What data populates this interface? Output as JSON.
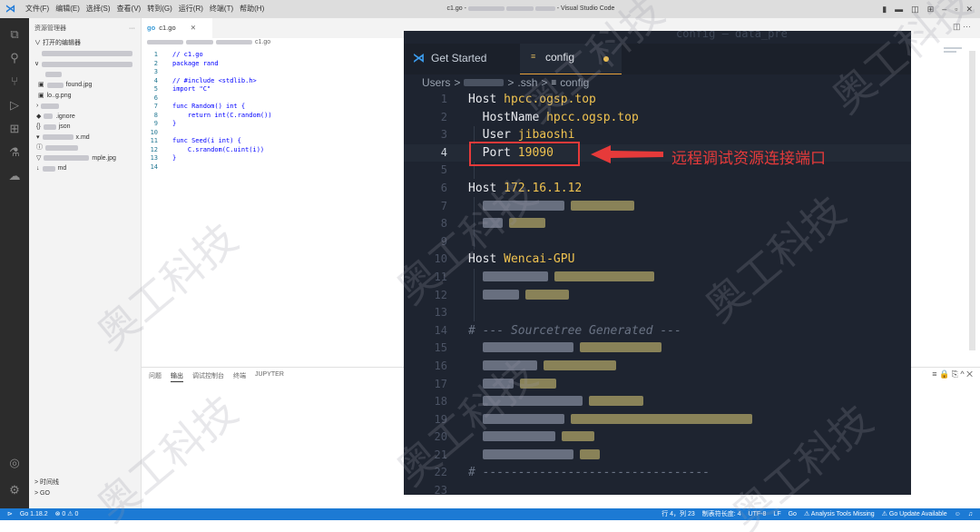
{
  "titlebar": {
    "menus": [
      "文件(F)",
      "编辑(E)",
      "选择(S)",
      "查看(V)",
      "转到(G)",
      "运行(R)",
      "终端(T)",
      "帮助(H)"
    ],
    "window_title": "c1.go - Visual Studio Code",
    "title_prefix": "c1.go -",
    "title_suffix": "- Visual Studio Code"
  },
  "sidebar": {
    "header": "资源管理器",
    "more": "···",
    "open_editors": "∨ 打开的编辑器",
    "files": {
      "found": "found.jpg",
      "logo": "lo..g.png",
      "ignore": ".ignore",
      "json": "json",
      "md": "x.md",
      "png": "mple.jpg",
      "readme": "md"
    },
    "outline": "> 时间线",
    "go": "> GO"
  },
  "editor": {
    "tab_label": "c1.go",
    "tab_icon": "go",
    "breadcrumb_file": "c1.go",
    "lines": [
      {
        "n": "1",
        "t": "// c1.go"
      },
      {
        "n": "2",
        "t": "package rand"
      },
      {
        "n": "3",
        "t": ""
      },
      {
        "n": "4",
        "t": "// #include <stdlib.h>"
      },
      {
        "n": "5",
        "t": "import \"C\""
      },
      {
        "n": "6",
        "t": ""
      },
      {
        "n": "7",
        "t": "func Random() int {"
      },
      {
        "n": "8",
        "t": "    return int(C.random())"
      },
      {
        "n": "9",
        "t": "}"
      },
      {
        "n": "10",
        "t": ""
      },
      {
        "n": "11",
        "t": "func Seed(i int) {"
      },
      {
        "n": "12",
        "t": "    C.srandom(C.uint(i))"
      },
      {
        "n": "13",
        "t": "}"
      },
      {
        "n": "14",
        "t": ""
      }
    ]
  },
  "panel": {
    "tabs": [
      "问题",
      "输出",
      "调试控制台",
      "终端",
      "JUPYTER"
    ],
    "active_tab": "输出"
  },
  "statusbar": {
    "left": [
      "Go 1.18.2",
      "⊗ 0 ⚠ 0"
    ],
    "position": "行 4，列 23",
    "tab_size": "制表符长度: 4",
    "encoding": "UTF-8",
    "eol": "LF",
    "language": "Go",
    "analysis": "⚠ Analysis Tools Missing",
    "update": "⚠ Go Update Available"
  },
  "overlay": {
    "bg_title": "config — data_pre",
    "tab_get_started": "Get Started",
    "tab_config": "config",
    "breadcrumb": {
      "users": "Users",
      "ssh": ".ssh",
      "file": "config"
    },
    "lines": [
      {
        "n": "1",
        "kw": "Host ",
        "val": "hpcc.ogsp.top"
      },
      {
        "n": "2",
        "kw": "  HostName ",
        "val": "hpcc.ogsp.top"
      },
      {
        "n": "3",
        "kw": "  User ",
        "val": "jibaoshi"
      },
      {
        "n": "4",
        "kw": "  Port ",
        "val": "19090"
      },
      {
        "n": "5",
        "kw": "",
        "val": ""
      },
      {
        "n": "6",
        "kw": "Host ",
        "val": "172.16.1.12"
      },
      {
        "n": "7",
        "kw": "",
        "val": ""
      },
      {
        "n": "8",
        "kw": "",
        "val": ""
      },
      {
        "n": "9",
        "kw": "",
        "val": ""
      },
      {
        "n": "10",
        "kw": "Host ",
        "val": "Wencai-GPU"
      },
      {
        "n": "11",
        "kw": "",
        "val": ""
      },
      {
        "n": "12",
        "kw": "",
        "val": ""
      },
      {
        "n": "13",
        "kw": "",
        "val": ""
      },
      {
        "n": "14",
        "kw": "",
        "val": "",
        "cmt": "# --- Sourcetree Generated ---"
      },
      {
        "n": "15",
        "kw": "",
        "val": ""
      },
      {
        "n": "16",
        "kw": "",
        "val": ""
      },
      {
        "n": "17",
        "kw": "",
        "val": ""
      },
      {
        "n": "18",
        "kw": "",
        "val": ""
      },
      {
        "n": "19",
        "kw": "",
        "val": ""
      },
      {
        "n": "20",
        "kw": "",
        "val": ""
      },
      {
        "n": "21",
        "kw": "",
        "val": ""
      },
      {
        "n": "22",
        "kw": "",
        "val": "",
        "cmt": "# --------------------------------"
      },
      {
        "n": "23",
        "kw": "",
        "val": ""
      }
    ],
    "annotation": "远程调试资源连接端口",
    "annotation_color": "#e63a3a"
  },
  "watermark": "奥工科技",
  "colors": {
    "accent": "#1c7ad4",
    "highlight_value": "#f0c350",
    "annotation": "#e63a3a"
  }
}
